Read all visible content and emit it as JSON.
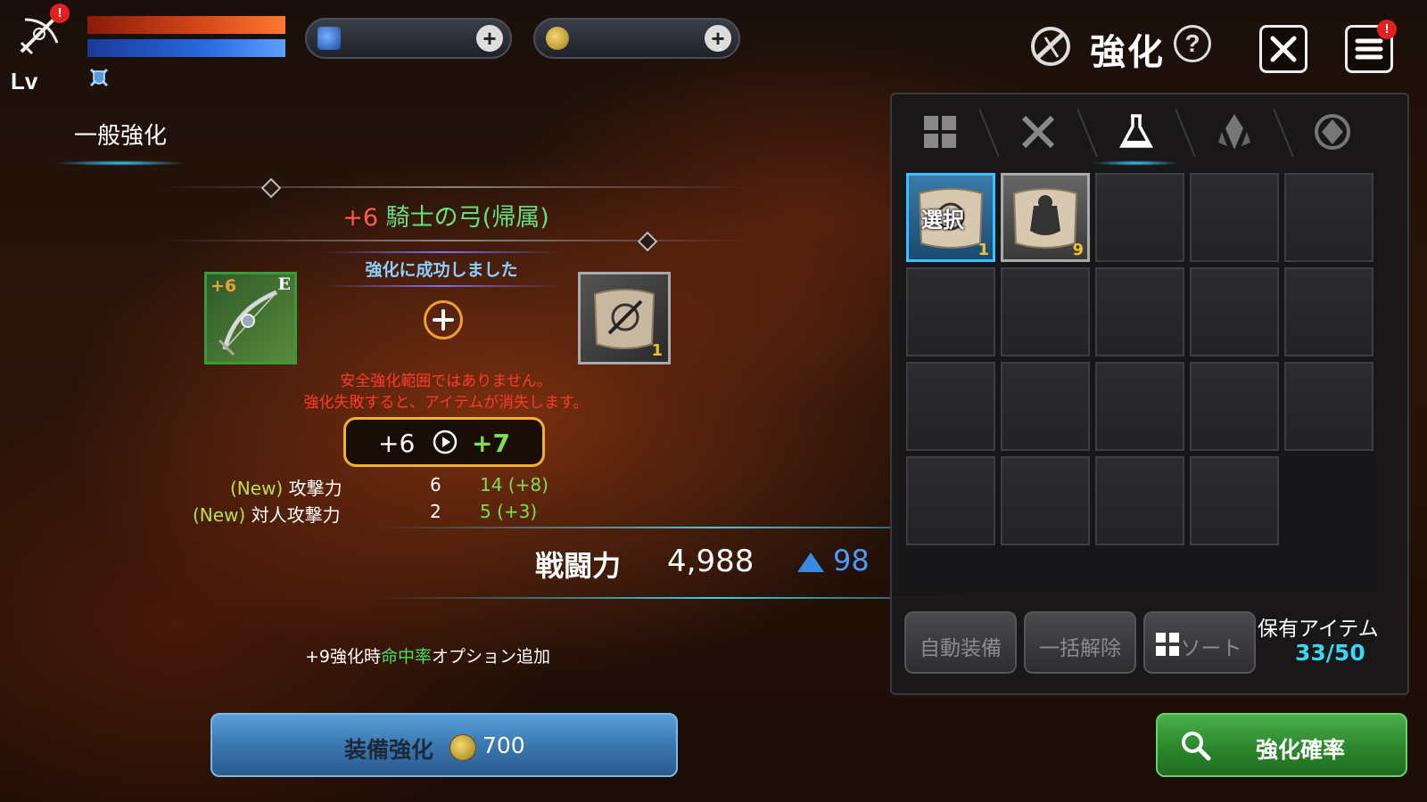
{
  "header": {
    "level_label": "Lv",
    "title": "強化",
    "help_label": "?",
    "currencies": [
      {
        "icon": "blue-gem-icon",
        "value": ""
      },
      {
        "icon": "gold-coin-icon",
        "value": ""
      }
    ],
    "alerts": {
      "profile": "!",
      "menu": "!"
    }
  },
  "mode_tab": {
    "label": "一般強化"
  },
  "enhance": {
    "item_level": "+6",
    "item_name": "騎士の弓(帰属)",
    "success_message": "強化に成功しました",
    "item_slot": {
      "plus": "+6",
      "grade": "E"
    },
    "scroll_slot": {
      "count": "1"
    },
    "warning_line1": "安全強化範囲ではありません。",
    "warning_line2": "強化失敗すると、アイテムが消失します。",
    "level_from": "+6",
    "level_to": "+7",
    "stats": [
      {
        "tag": "(New)",
        "name": "攻撃力",
        "base": "6",
        "next": "14 (+8)"
      },
      {
        "tag": "(New)",
        "name": "対人攻撃力",
        "base": "2",
        "next": "5 (+3)"
      }
    ],
    "power_label": "戦闘力",
    "power_value": "4,988",
    "power_diff": "98",
    "bonus_prefix": "+9強化時",
    "bonus_highlight": "命中率",
    "bonus_suffix": "オプション追加",
    "button_label": "装備強化",
    "button_cost": "700"
  },
  "inventory": {
    "tabs": [
      "all-grid-icon",
      "weapon-icon",
      "potion-icon",
      "crystal-icon",
      "emblem-icon"
    ],
    "active_tab": 2,
    "items": [
      {
        "tag": "選択",
        "count": "1",
        "selected": true
      },
      {
        "tag": "",
        "count": "9",
        "selected": false
      }
    ],
    "total_cells": 19,
    "auto_equip_label": "自動装備",
    "release_all_label": "一括解除",
    "sort_label": "ソート",
    "hold_label": "保有アイテム",
    "hold_count": "33/50",
    "probability_label": "強化確率"
  },
  "colors": {
    "accent_cyan": "#3ad0e0",
    "success_green": "#7de04a",
    "warning_red": "#ff3a2a",
    "gold_border": "#f0b030"
  }
}
